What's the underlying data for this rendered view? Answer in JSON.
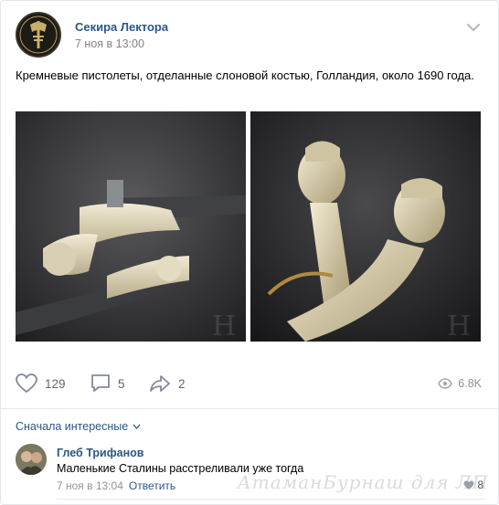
{
  "post": {
    "author": "Секира Лектора",
    "date": "7 ноя в 13:00",
    "text": "Кремневые пистолеты, отделанные слоновой костью, Голландия, около 1690 года."
  },
  "actions": {
    "likes": "129",
    "comments": "5",
    "shares": "2",
    "views": "6.8K"
  },
  "comments_section": {
    "sort_label": "Сначала интересные",
    "items": [
      {
        "author": "Глеб Трифанов",
        "text": "Маленькие Сталины расстреливали уже тогда",
        "date": "7 ноя в 13:04",
        "reply_label": "Ответить",
        "likes": "8"
      }
    ]
  },
  "watermark": "АтаманБурнаш для ЛП",
  "colors": {
    "link": "#2a5885",
    "meta": "#828282",
    "divider": "#e7e8ec"
  }
}
